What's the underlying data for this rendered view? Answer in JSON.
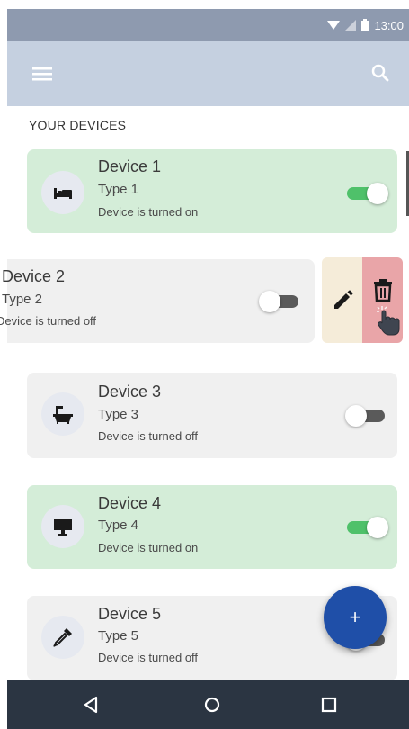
{
  "status_bar": {
    "time": "13:00",
    "icons": [
      "wifi-icon",
      "signal-icon",
      "battery-icon"
    ]
  },
  "app_bar": {
    "menu_icon": "menu-icon",
    "search_icon": "search-icon"
  },
  "section_title": "YOUR DEVICES",
  "devices": [
    {
      "name": "Device 1",
      "type": "Type 1",
      "status": "Device is turned on",
      "on": true,
      "icon": "bed-icon"
    },
    {
      "name": "Device 2",
      "type": "Type 2",
      "status": "Device is turned off",
      "on": false,
      "icon": ""
    },
    {
      "name": "Device 3",
      "type": "Type 3",
      "status": "Device is turned off",
      "on": false,
      "icon": "bathtub-icon"
    },
    {
      "name": "Device 4",
      "type": "Type 4",
      "status": "Device is turned on",
      "on": true,
      "icon": "monitor-icon"
    },
    {
      "name": "Device 5",
      "type": "Type 5",
      "status": "Device is turned off",
      "on": false,
      "icon": "pipette-icon"
    }
  ],
  "swipe_actions": {
    "edit_icon": "pencil-icon",
    "delete_icon": "trash-icon",
    "cursor_icon": "hand-pointer-icon"
  },
  "fab": {
    "label": "+",
    "icon": "plus-icon"
  },
  "nav_bar": {
    "icons": [
      "back-icon",
      "home-icon",
      "recents-icon"
    ]
  },
  "colors": {
    "status_bar": "#8e9aaf",
    "app_bar": "#c5d0e0",
    "card_on": "#d4edd8",
    "card_off": "#f0f0f0",
    "toggle_on": "#4fc16a",
    "edit_action": "#f5ecd9",
    "delete_action": "#e9a5a8",
    "fab": "#1f4fa8",
    "nav_bar": "#2b3542"
  }
}
